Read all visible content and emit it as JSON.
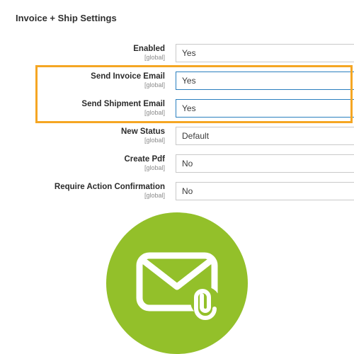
{
  "title": "Invoice + Ship Settings",
  "scope_label": "[global]",
  "fields": [
    {
      "label": "Enabled",
      "value": "Yes"
    },
    {
      "label": "Send Invoice Email",
      "value": "Yes"
    },
    {
      "label": "Send Shipment Email",
      "value": "Yes"
    },
    {
      "label": "New Status",
      "value": "Default"
    },
    {
      "label": "Create Pdf",
      "value": "No"
    },
    {
      "label": "Require Action Confirmation",
      "value": "No"
    }
  ]
}
